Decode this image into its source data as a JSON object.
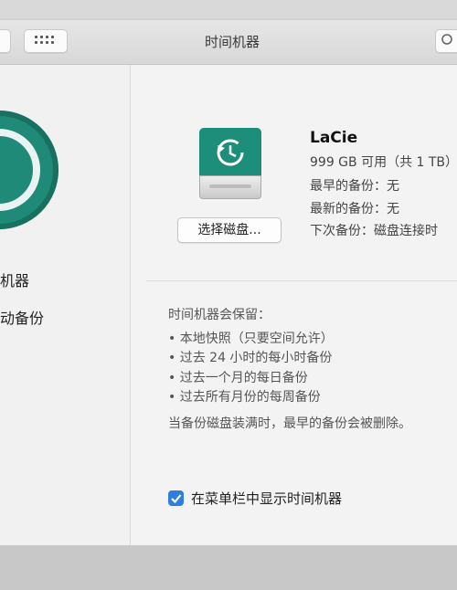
{
  "window": {
    "title": "时间机器"
  },
  "sidebar": {
    "label_line1": "机器",
    "label_line2": "动备份"
  },
  "disk": {
    "name": "LaCie",
    "capacity": "999 GB 可用（共 1 TB）",
    "oldest": "最早的备份：无",
    "latest": "最新的备份：无",
    "next": "下次备份：磁盘连接时",
    "select_button": "选择磁盘..."
  },
  "retention": {
    "heading": "时间机器会保留：",
    "items": [
      "• 本地快照（只要空间允许）",
      "• 过去 24 小时的每小时备份",
      "• 过去一个月的每日备份",
      "• 过去所有月份的每周备份"
    ],
    "note": "当备份磁盘装满时，最早的备份会被删除。"
  },
  "menubar_option": {
    "label": "在菜单栏中显示时间机器",
    "checked": true
  },
  "colors": {
    "accent": "#2f7ddf",
    "timemachine_green": "#1e8a77"
  }
}
